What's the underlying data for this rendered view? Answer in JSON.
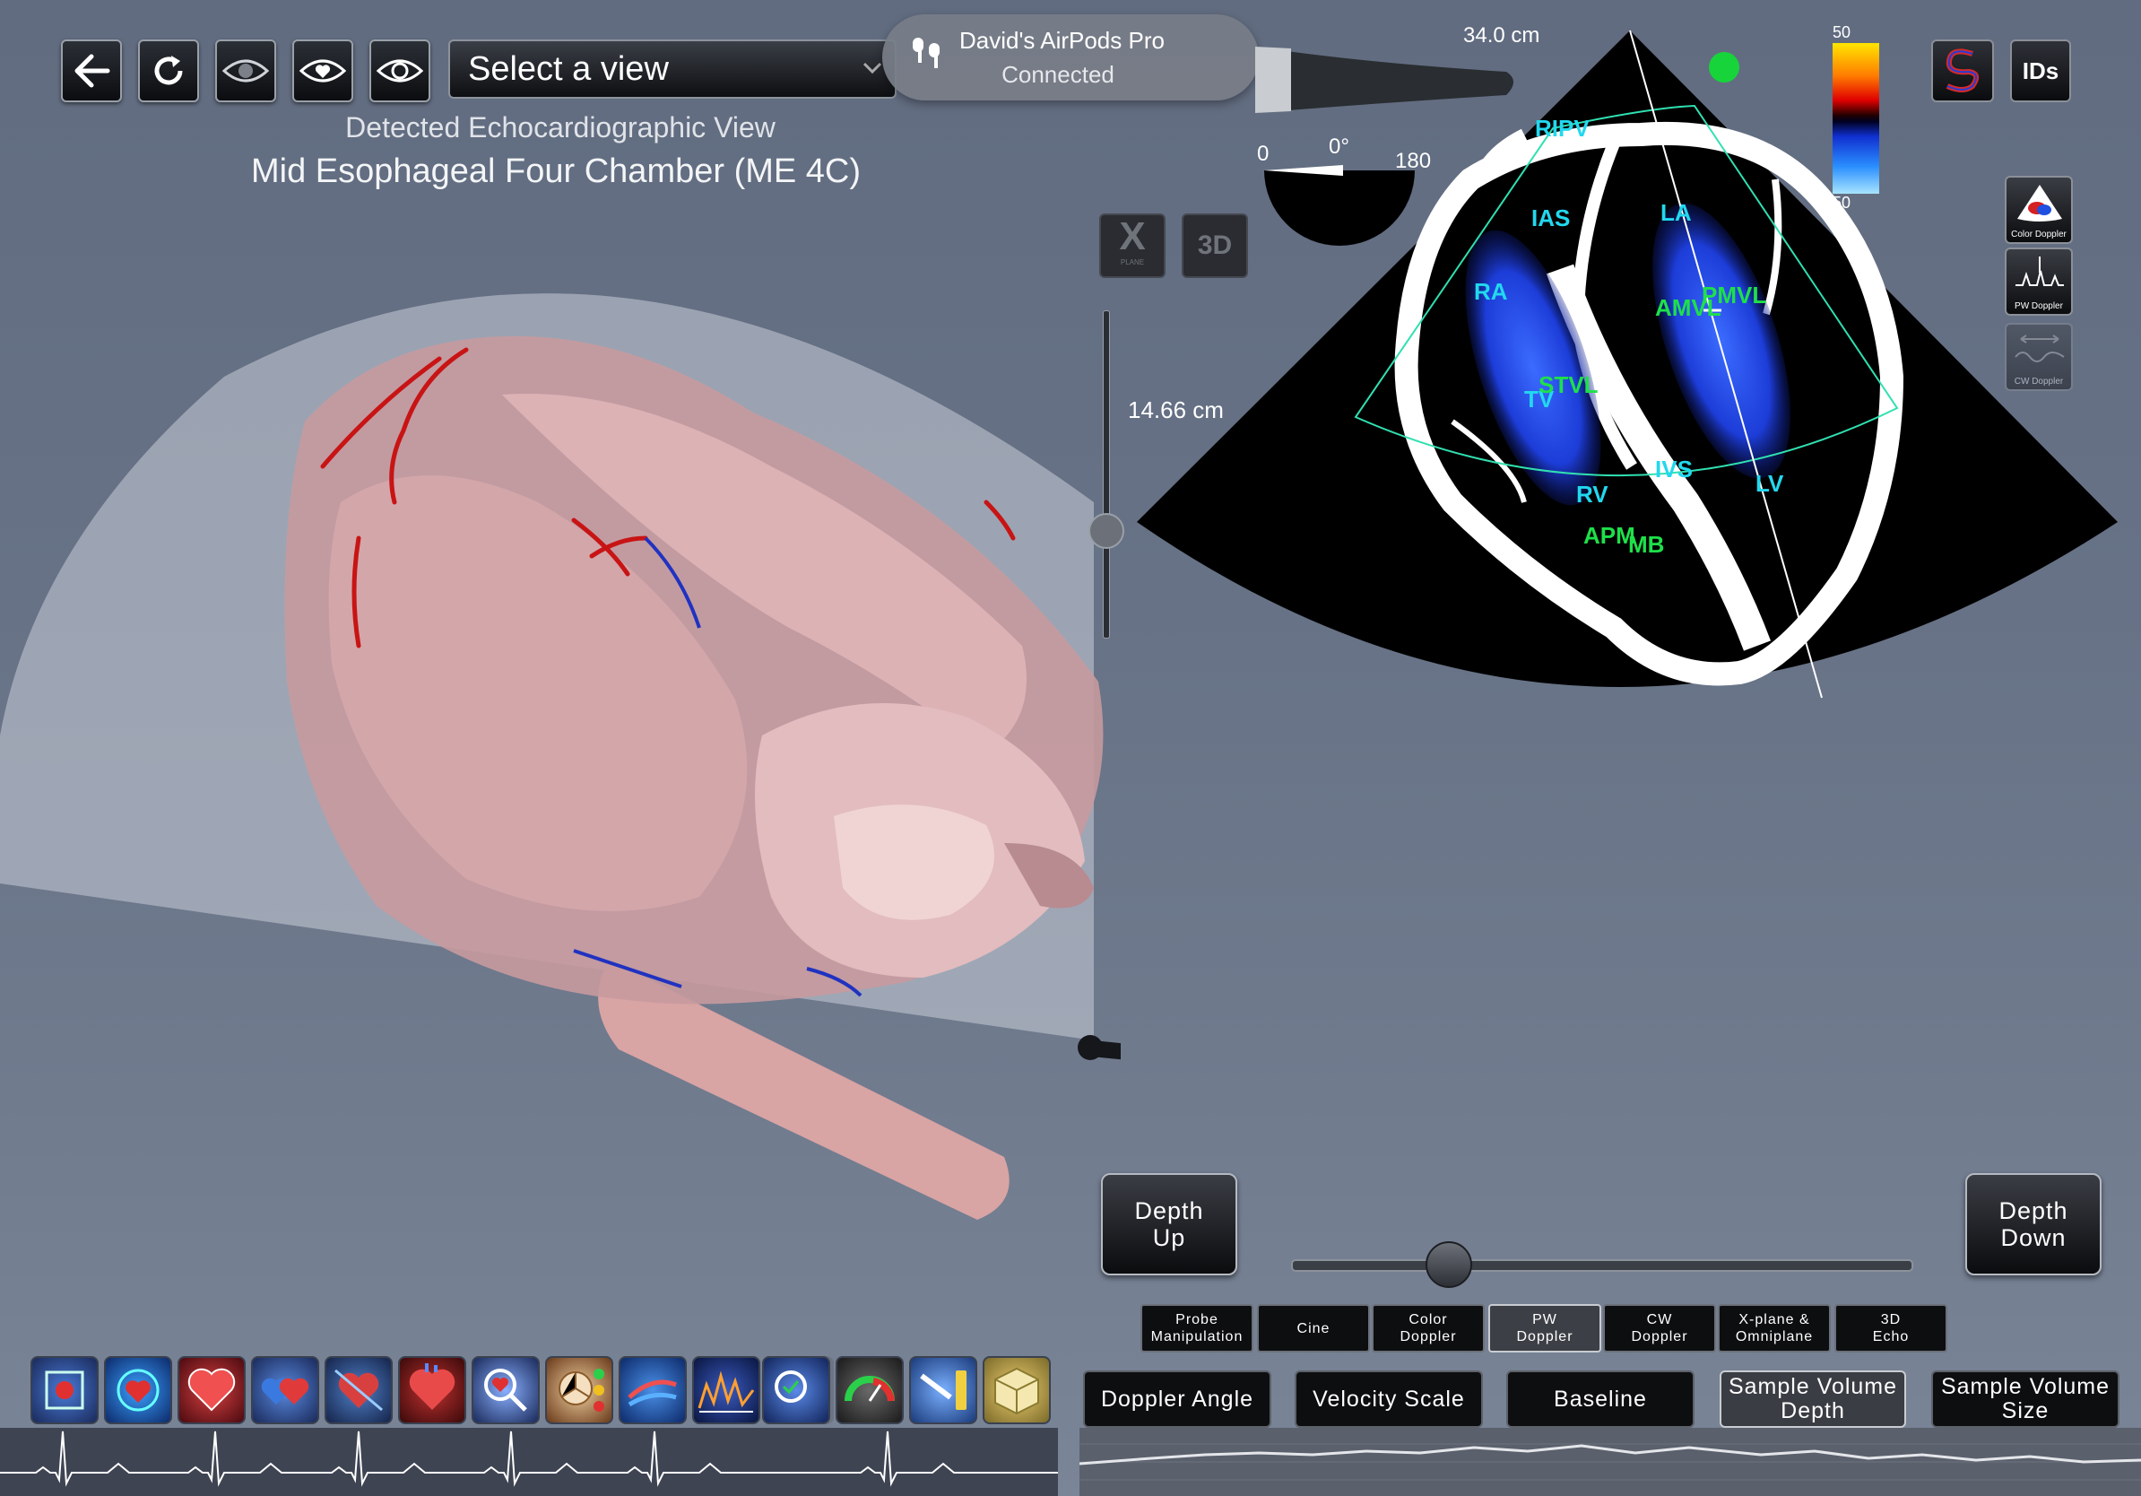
{
  "toolbar": {
    "select_view_label": "Select a view"
  },
  "airpods": {
    "device": "David's AirPods Pro",
    "status": "Connected"
  },
  "detected": {
    "caption": "Detected Echocardiographic View",
    "view_name": "Mid Esophageal Four Chamber (ME 4C)"
  },
  "probe": {
    "length": "34.0 cm",
    "angle_value": "0°",
    "angle_min": "0",
    "angle_max": "180"
  },
  "mode_buttons": {
    "xplane": "X",
    "xplane_sub": "PLANE",
    "threed": "3D"
  },
  "depth": {
    "value": "14.66 cm",
    "slider_fraction": 0.6
  },
  "color_scale": {
    "top": "50",
    "bottom": "50"
  },
  "top_right": {
    "ids_label": "IDs"
  },
  "side_icons": {
    "color_doppler": "Color Doppler",
    "pw_doppler": "PW Doppler",
    "cw_doppler": "CW Doppler"
  },
  "echo_labels": {
    "cyan": [
      "RIPV",
      "IAS",
      "LA",
      "RA",
      "TV",
      "RV",
      "IVS",
      "LV"
    ],
    "green": [
      "AMVL",
      "PMVL",
      "STVL",
      "APM",
      "MB"
    ]
  },
  "depth_buttons": {
    "up": [
      "Depth",
      "Up"
    ],
    "down": [
      "Depth",
      "Down"
    ]
  },
  "tabs": [
    {
      "line1": "Probe",
      "line2": "Manipulation"
    },
    {
      "line1": "Cine",
      "line2": ""
    },
    {
      "line1": "Color",
      "line2": "Doppler"
    },
    {
      "line1": "PW",
      "line2": "Doppler"
    },
    {
      "line1": "CW",
      "line2": "Doppler"
    },
    {
      "line1": "X-plane &",
      "line2": "Omniplane"
    },
    {
      "line1": "3D",
      "line2": "Echo"
    }
  ],
  "controls": [
    {
      "line1": "Doppler Angle",
      "line2": ""
    },
    {
      "line1": "Velocity Scale",
      "line2": ""
    },
    {
      "line1": "Baseline",
      "line2": ""
    },
    {
      "line1": "Sample Volume",
      "line2": "Depth"
    },
    {
      "line1": "Sample Volume",
      "line2": "Size"
    }
  ],
  "colors": {
    "accent_cyan": "#22d8ee",
    "accent_green": "#1ee04a",
    "status_dot": "#17d43a"
  }
}
